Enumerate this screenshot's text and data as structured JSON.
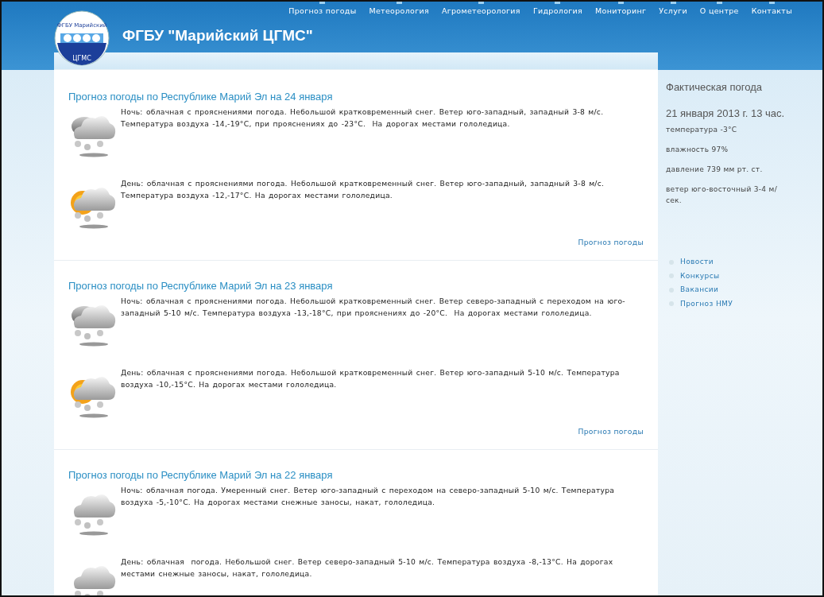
{
  "header": {
    "logo": {
      "top_text": "ФГБУ Марийский",
      "bottom_text": "ЦГМС"
    },
    "title": "ФГБУ \"Марийский ЦГМС\"",
    "nav": [
      {
        "label": "Прогноз погоды"
      },
      {
        "label": "Метеорология"
      },
      {
        "label": "Агрометеорология"
      },
      {
        "label": "Гидрология"
      },
      {
        "label": "Мониторинг"
      },
      {
        "label": "Услуги"
      },
      {
        "label": "О центре"
      },
      {
        "label": "Контакты"
      }
    ]
  },
  "forecasts": [
    {
      "title": "Прогноз погоды по Республике Марий Эл на 24 января",
      "periods": [
        {
          "kind": "night",
          "text": "Ночь: облачная с прояснениями погода. Небольшой кратковременный снег. Ветер юго-западный, западный 3-8 м/с. Температура воздуха -14,-19°С, при прояснениях до -23°С.  На дорогах местами гололедица."
        },
        {
          "kind": "day",
          "text": "День: облачная с прояснениями погода. Небольшой кратковременный снег. Ветер юго-западный, западный 3-8 м/с. Температура воздуха -12,-17°С. На дорогах местами гололедица."
        }
      ],
      "link": "Прогноз погоды"
    },
    {
      "title": "Прогноз погоды по Республике Марий Эл на 23 января",
      "periods": [
        {
          "kind": "night",
          "text": "Ночь: облачная с прояснениями погода. Небольшой кратковременный снег. Ветер северо-западный с переходом на юго-западный 5-10 м/с. Температура воздуха -13,-18°С, при прояснениях до -20°С.  На дорогах местами гололедица."
        },
        {
          "kind": "day",
          "text": "День: облачная с прояснениями погода. Небольшой кратковременный снег. Ветер юго-западный 5-10 м/с. Температура воздуха -10,-15°С. На дорогах местами гололедица."
        }
      ],
      "link": "Прогноз погоды"
    },
    {
      "title": "Прогноз погоды по Республике Марий Эл на 22 января",
      "periods": [
        {
          "kind": "overcast",
          "text": "Ночь: облачная погода. Умеренный снег. Ветер юго-западный с переходом на северо-западный 5-10 м/с. Температура воздуха -5,-10°С. На дорогах местами снежные заносы, накат, гололедица."
        },
        {
          "kind": "overcast",
          "text": "День: облачная  погода. Небольшой снег. Ветер северо-западный 5-10 м/с. Температура воздуха -8,-13°С. На дорогах местами снежные заносы, накат, гололедица."
        }
      ]
    }
  ],
  "sidebar": {
    "title": "Фактическая погода",
    "date": "21 января 2013 г. 13 час.",
    "observations": [
      "температура -3°С",
      "влажность 97%",
      "давление 739 мм рт. ст.",
      "ветер юго-восточный 3-4 м/сек."
    ],
    "links": [
      "Новости",
      "Конкурсы",
      "Вакансии",
      "Прогноз НМУ"
    ]
  }
}
